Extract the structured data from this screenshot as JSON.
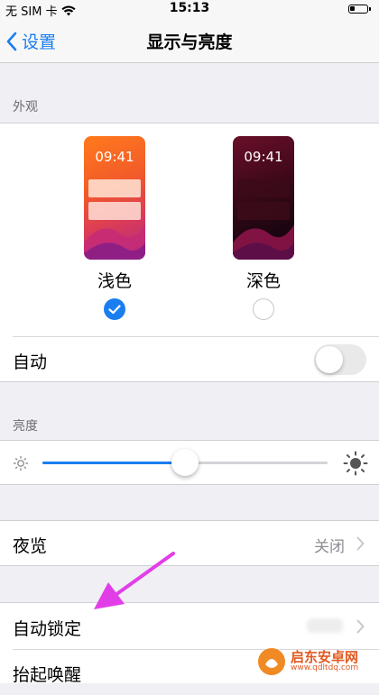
{
  "status_bar": {
    "carrier": "无 SIM 卡",
    "time": "15:13"
  },
  "nav": {
    "back_label": "设置",
    "title": "显示与亮度"
  },
  "appearance": {
    "section_label": "外观",
    "light": {
      "preview_time": "09:41",
      "label": "浅色",
      "selected": true
    },
    "dark": {
      "preview_time": "09:41",
      "label": "深色",
      "selected": false
    },
    "auto_label": "自动",
    "auto_on": false
  },
  "brightness": {
    "section_label": "亮度",
    "level": 0.5
  },
  "night_shift": {
    "label": "夜览",
    "value": "关闭"
  },
  "auto_lock": {
    "label": "自动锁定"
  },
  "raise_to_wake": {
    "label": "抬起唤醒"
  },
  "watermark": {
    "name": "启东安卓网",
    "url": "www.qdltdq.com"
  },
  "colors": {
    "accent": "#1a7ef0",
    "annotation_arrow": "#e23ee8"
  },
  "icons": [
    "wifi-icon",
    "battery-icon",
    "back-chevron-icon",
    "checkmark-icon",
    "sun-small-icon",
    "sun-large-icon",
    "chevron-right-icon"
  ]
}
